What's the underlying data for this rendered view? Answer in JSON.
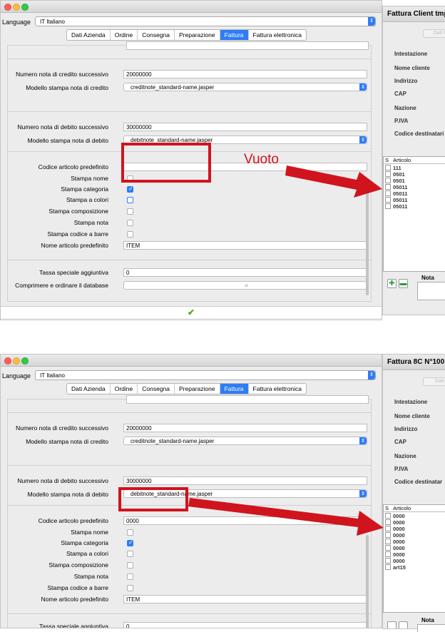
{
  "top": {
    "language_label": "Language",
    "language_value": "IT Italiano",
    "tabs": [
      "Dati Azienda",
      "Ordine",
      "Consegna",
      "Preparazione",
      "Fattura",
      "Fattura elettronica"
    ],
    "active_tab": "Fattura",
    "fields": {
      "credit_next_label": "Numero nota di credito successivo",
      "credit_next_value": "20000000",
      "credit_model_label": "Modello stampa nota di credito",
      "credit_model_value": "creditnote_standard-name.jasper",
      "debit_next_label": "Numero nota di debito successivo",
      "debit_next_value": "30000000",
      "debit_model_label": "Modello stampa nota di debito",
      "debit_model_value": "debitnote_standard-name.jasper",
      "default_code_label": "Codice articolo predefinito",
      "default_code_value": "",
      "print_name_label": "Stampa nome",
      "print_category_label": "Stampa categoria",
      "print_color_label": "Stampa a colori",
      "print_composition_label": "Stampa composizione",
      "print_note_label": "Stampa nota",
      "print_barcode_label": "Stampa codice a barre",
      "default_name_label": "Nome articolo predefinito",
      "default_name_value": "ITEM",
      "special_tax_label": "Tassa speciale aggiuntiva",
      "special_tax_value": "0",
      "compress_label": "Comprimere e ordinare il database"
    },
    "checkboxes": {
      "print_name": false,
      "print_category": true,
      "print_color": false,
      "print_composition": false,
      "print_note": false,
      "print_barcode": false
    },
    "annotation": "Vuoto",
    "right_window": {
      "title": "Fattura Client tmp",
      "button_label": "Dati Fa",
      "labels": [
        "Intestazione",
        "Nome cliente",
        "Indirizzo",
        "CAP",
        "Nazione",
        "P.IVA",
        "Codice destinatari"
      ],
      "list_header_s": "S",
      "list_header_col": "Articolo",
      "items": [
        "111",
        "0501",
        "0501",
        "05011",
        "05011",
        "05011",
        "05011"
      ],
      "note_label": "Nota"
    }
  },
  "bottom": {
    "language_label": "Language",
    "language_value": "IT Italiano",
    "tabs": [
      "Dati Azienda",
      "Ordine",
      "Consegna",
      "Preparazione",
      "Fattura",
      "Fattura elettronica"
    ],
    "active_tab": "Fattura",
    "fields": {
      "credit_next_label": "Numero nota di credito successivo",
      "credit_next_value": "20000000",
      "credit_model_label": "Modello stampa nota di credito",
      "credit_model_value": "creditnote_standard-name.jasper",
      "debit_next_label": "Numero nota di debito successivo",
      "debit_next_value": "30000000",
      "debit_model_label": "Modello stampa nota di debito",
      "debit_model_value": "debitnote_standard-name.jasper",
      "default_code_label": "Codice articolo predefinito",
      "default_code_value": "0000",
      "print_name_label": "Stampa nome",
      "print_category_label": "Stampa categoria",
      "print_color_label": "Stampa a colori",
      "print_composition_label": "Stampa composizione",
      "print_note_label": "Stampa nota",
      "print_barcode_label": "Stampa codice a barre",
      "default_name_label": "Nome articolo predefinito",
      "default_name_value": "ITEM",
      "special_tax_label": "Tassa speciale aggiuntiva",
      "special_tax_value": "0"
    },
    "checkboxes": {
      "print_name": false,
      "print_category": true,
      "print_color": false,
      "print_composition": false,
      "print_note": false,
      "print_barcode": false
    },
    "right_window": {
      "title": "Fattura 8C N°100",
      "button_label": "Dati c",
      "labels": [
        "Intestazione",
        "Nome cliente",
        "Indirizzo",
        "CAP",
        "Nazione",
        "P.IVA",
        "Codice destinatar"
      ],
      "list_header_s": "S",
      "list_header_col": "Articolo",
      "items": [
        "0000",
        "0000",
        "0000",
        "0000",
        "0000",
        "0000",
        "0000",
        "0000",
        "art15"
      ],
      "note_label": "Nota"
    }
  },
  "colors": {
    "accent": "#2f7df6",
    "annotation_red": "#d0141d",
    "confirm_green": "#4caf1e"
  },
  "icons": {
    "confirm": "checkmark-icon",
    "add": "add-icon",
    "remove": "remove-icon"
  }
}
